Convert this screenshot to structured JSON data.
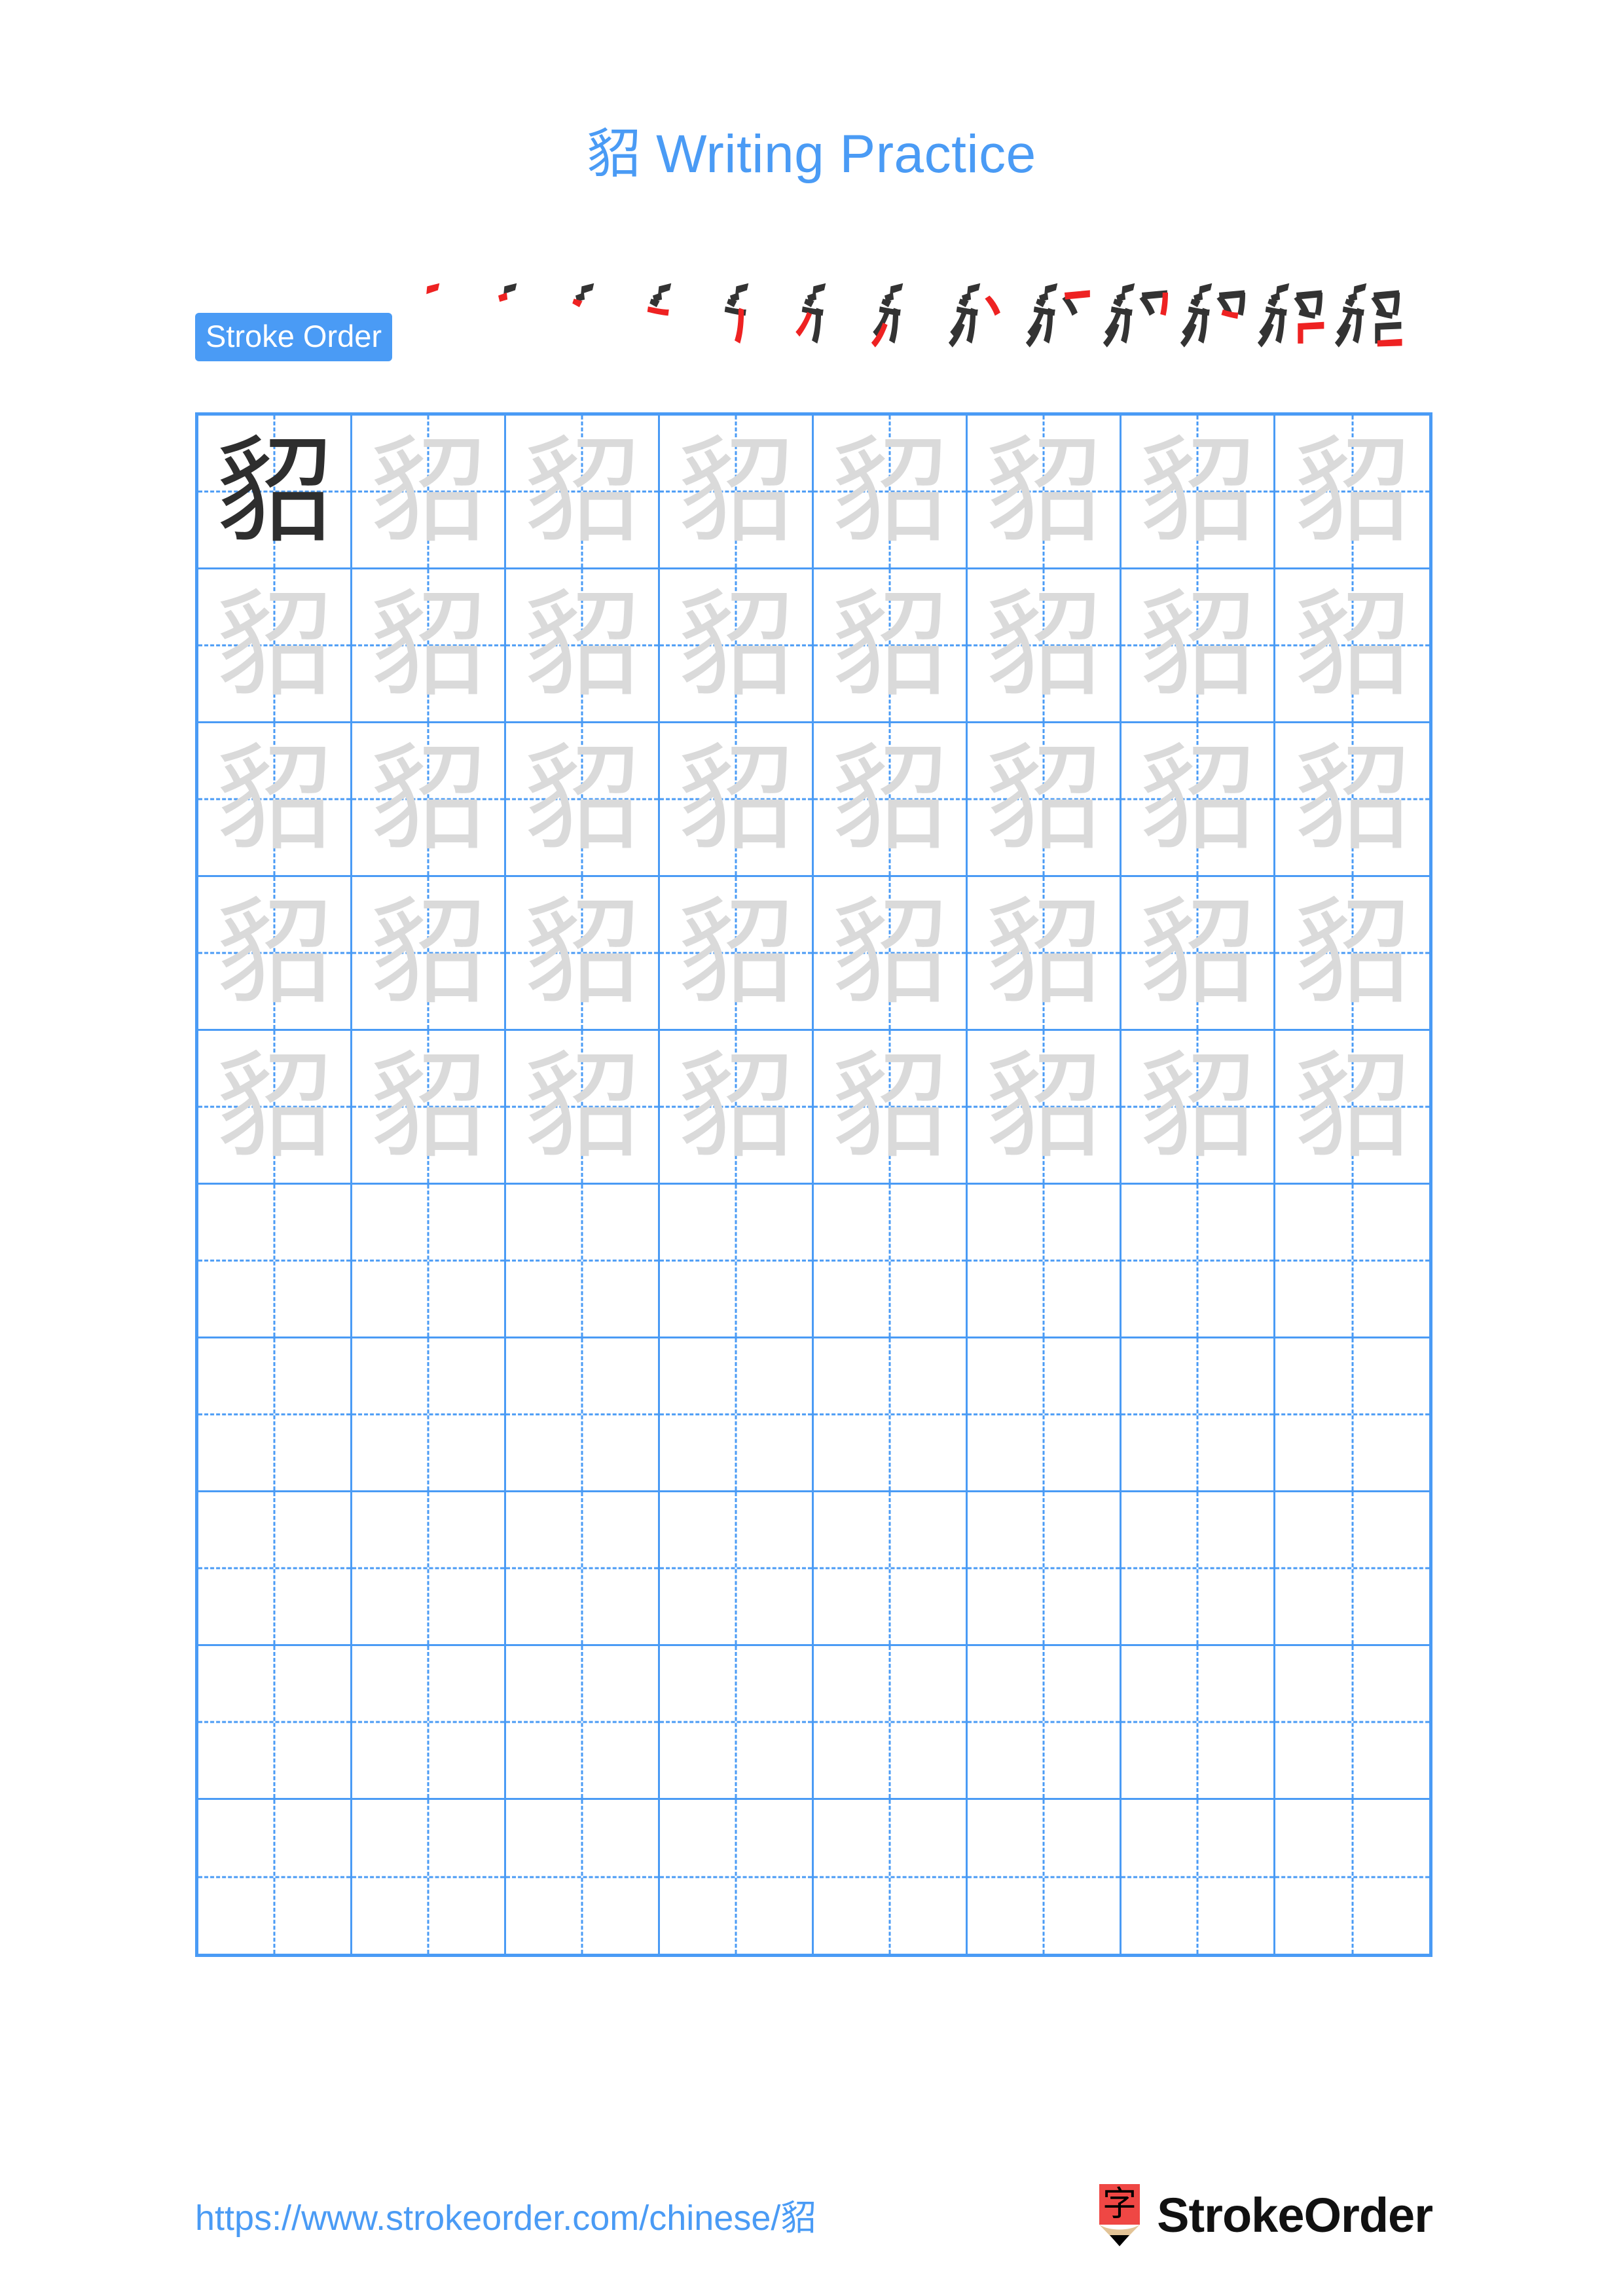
{
  "page": {
    "character": "貂",
    "title_prefix": "貂",
    "title_suffix": " Writing Practice"
  },
  "stroke_order": {
    "label": "Stroke Order",
    "total_strokes": 13,
    "colors": {
      "existing_stroke": "#333333",
      "new_stroke": "#ee2222"
    },
    "steps": [
      {
        "index": 1,
        "new_stroke_count": 1,
        "cumulative_strokes": 1
      },
      {
        "index": 2,
        "new_stroke_count": 1,
        "cumulative_strokes": 2
      },
      {
        "index": 3,
        "new_stroke_count": 1,
        "cumulative_strokes": 3
      },
      {
        "index": 4,
        "new_stroke_count": 1,
        "cumulative_strokes": 4
      },
      {
        "index": 5,
        "new_stroke_count": 1,
        "cumulative_strokes": 5
      },
      {
        "index": 6,
        "new_stroke_count": 1,
        "cumulative_strokes": 6
      },
      {
        "index": 7,
        "new_stroke_count": 1,
        "cumulative_strokes": 7
      },
      {
        "index": 8,
        "new_stroke_count": 1,
        "cumulative_strokes": 8
      },
      {
        "index": 9,
        "new_stroke_count": 1,
        "cumulative_strokes": 9
      },
      {
        "index": 10,
        "new_stroke_count": 1,
        "cumulative_strokes": 10
      },
      {
        "index": 11,
        "new_stroke_count": 1,
        "cumulative_strokes": 11
      },
      {
        "index": 12,
        "new_stroke_count": 1,
        "cumulative_strokes": 12
      },
      {
        "index": 13,
        "new_stroke_count": 1,
        "cumulative_strokes": 13
      }
    ]
  },
  "grid": {
    "columns": 8,
    "rows": 10,
    "line_color": "#4a9bf5",
    "solid_glyph_color": "#2e2e2e",
    "trace_glyph_color": "#dadada",
    "cells": [
      [
        "solid",
        "trace",
        "trace",
        "trace",
        "trace",
        "trace",
        "trace",
        "trace"
      ],
      [
        "trace",
        "trace",
        "trace",
        "trace",
        "trace",
        "trace",
        "trace",
        "trace"
      ],
      [
        "trace",
        "trace",
        "trace",
        "trace",
        "trace",
        "trace",
        "trace",
        "trace"
      ],
      [
        "trace",
        "trace",
        "trace",
        "trace",
        "trace",
        "trace",
        "trace",
        "trace"
      ],
      [
        "trace",
        "trace",
        "trace",
        "trace",
        "trace",
        "trace",
        "trace",
        "trace"
      ],
      [
        "blank",
        "blank",
        "blank",
        "blank",
        "blank",
        "blank",
        "blank",
        "blank"
      ],
      [
        "blank",
        "blank",
        "blank",
        "blank",
        "blank",
        "blank",
        "blank",
        "blank"
      ],
      [
        "blank",
        "blank",
        "blank",
        "blank",
        "blank",
        "blank",
        "blank",
        "blank"
      ],
      [
        "blank",
        "blank",
        "blank",
        "blank",
        "blank",
        "blank",
        "blank",
        "blank"
      ],
      [
        "blank",
        "blank",
        "blank",
        "blank",
        "blank",
        "blank",
        "blank",
        "blank"
      ]
    ]
  },
  "footer": {
    "url_prefix": "https://www.strokeorder.com/chinese/",
    "url_character": "貂",
    "brand_name": "StrokeOrder",
    "logo_character": "字",
    "logo_body_color": "#ef4744",
    "logo_wood_color": "#e2c396",
    "logo_tip_color": "#000000"
  }
}
